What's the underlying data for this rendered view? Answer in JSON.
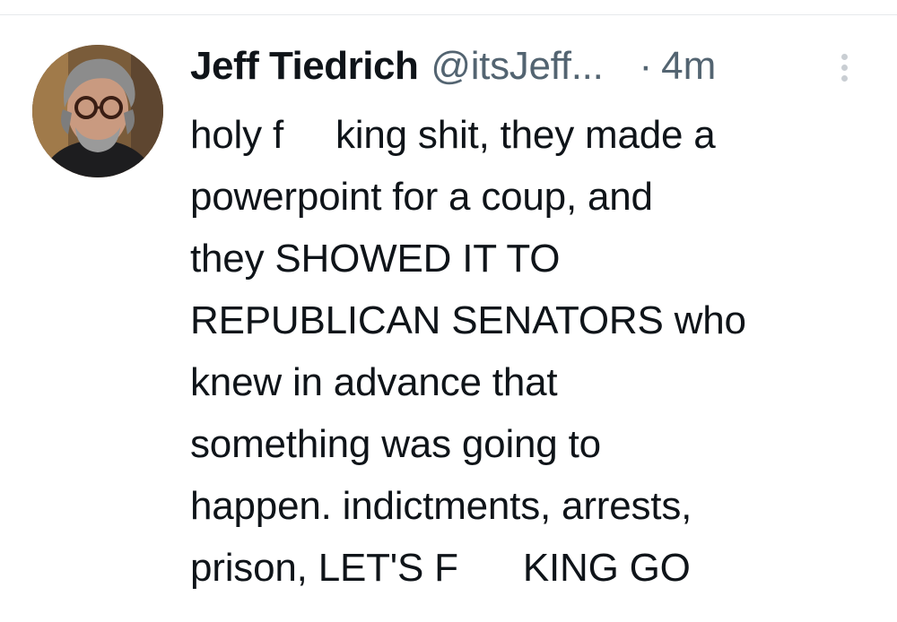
{
  "tweet": {
    "author_name": "Jeff Tiedrich",
    "author_handle": "@itsJeff...",
    "separator": "·",
    "timestamp": "4m",
    "more_icon": "more-vertical-icon",
    "avatar_icon": "user-avatar-photo",
    "text_lines": [
      [
        "holy f",
        "king shit, they made a"
      ],
      "powerpoint for a coup, and",
      "they SHOWED IT TO",
      "REPUBLICAN SENATORS who",
      "knew in advance that",
      "something was going to",
      "happen. indictments, arrests,",
      [
        "prison, LET'S F",
        "KING GO"
      ]
    ]
  },
  "colors": {
    "text": "#0f1419",
    "secondary": "#536471",
    "divider": "#e6e9ec",
    "more_icon": "#c9ced3"
  }
}
